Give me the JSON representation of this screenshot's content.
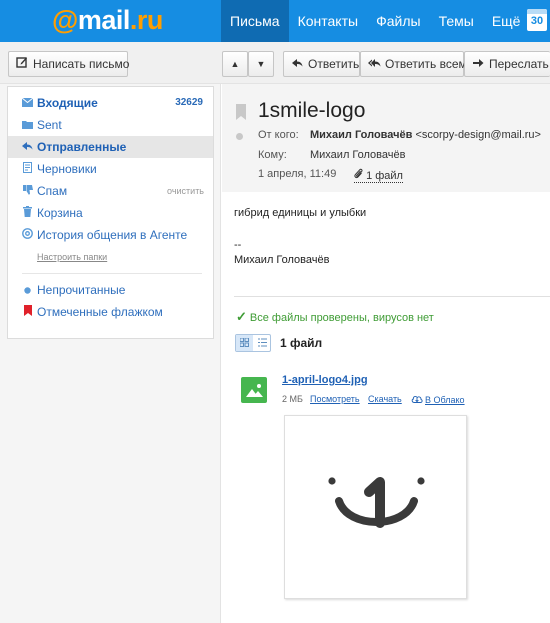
{
  "header": {
    "logo_at": "@",
    "logo_main": "mail",
    "logo_ru": ".ru",
    "nav": [
      "Письма",
      "Контакты",
      "Файлы",
      "Темы",
      "Ещё"
    ],
    "calendar_day": "30"
  },
  "toolbar": {
    "compose_label": "Написать письмо",
    "prev_label": "▲",
    "next_label": "▼",
    "reply_label": "Ответить",
    "reply_all_label": "Ответить всем",
    "forward_label": "Переслать"
  },
  "sidebar": {
    "items": [
      {
        "label": "Входящие",
        "count": "32629"
      },
      {
        "label": "Sent"
      },
      {
        "label": "Отправленные"
      },
      {
        "label": "Черновики"
      },
      {
        "label": "Спам",
        "action": "очистить"
      },
      {
        "label": "Корзина"
      },
      {
        "label": "История общения в Агенте"
      }
    ],
    "setup_link": "Настроить папки",
    "filters": [
      {
        "label": "Непрочитанные"
      },
      {
        "label": "Отмеченные флажком"
      }
    ]
  },
  "message": {
    "subject": "1smile-logo",
    "from_label": "От кого:",
    "from_name": "Михаил Головачёв",
    "from_email": "<scorpy-design@mail.ru>",
    "to_label": "Кому:",
    "to_name": "Михаил Головачёв",
    "date": "1 апреля, 11:49",
    "attachment_link": "1 файл",
    "body_line1": "гибрид единицы и улыбки",
    "signature_dash": "--",
    "signature_name": "Михаил Головачёв"
  },
  "attachments": {
    "virus_status": "Все файлы проверены, вирусов нет",
    "count_label": "1 файл",
    "file": {
      "name": "1-april-logo4.jpg",
      "size": "2 МБ",
      "view_label": "Посмотреть",
      "download_label": "Скачать",
      "cloud_label": "В Облако"
    }
  },
  "colors": {
    "header_blue": "#168de2",
    "active_tab": "#0f6bb2",
    "logo_orange": "#ff9e00",
    "virus_green": "#3f9c35",
    "file_icon_green": "#46b64f",
    "flag_red": "#e0212a"
  }
}
